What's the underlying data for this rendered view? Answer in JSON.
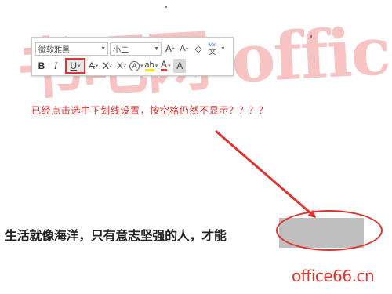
{
  "watermark": {
    "text": "书吧网 office教程网"
  },
  "toolbar": {
    "font_name": "微软雅黑",
    "font_size": "小二",
    "grow_font": "A",
    "shrink_font": "A",
    "clear_format": "◇",
    "phonetic_top": "wén",
    "phonetic_bottom": "文",
    "bold": "B",
    "italic": "I",
    "underline": "U",
    "strikethrough": "A",
    "superscript_base": "X",
    "superscript_mark": "2",
    "subscript_base": "X",
    "subscript_mark": "2",
    "text_effects": "A",
    "highlight": "ab",
    "font_color": "A",
    "char_shading": "A",
    "circled_char": "字",
    "accent_red": "#e0342f"
  },
  "question_text": "已经点击选中下划线设置，按空格仍然不显示？？？？",
  "document": {
    "sentence": "生活就像海洋，只有意志坚强的人，才能"
  },
  "site_mark": "office66.cn"
}
